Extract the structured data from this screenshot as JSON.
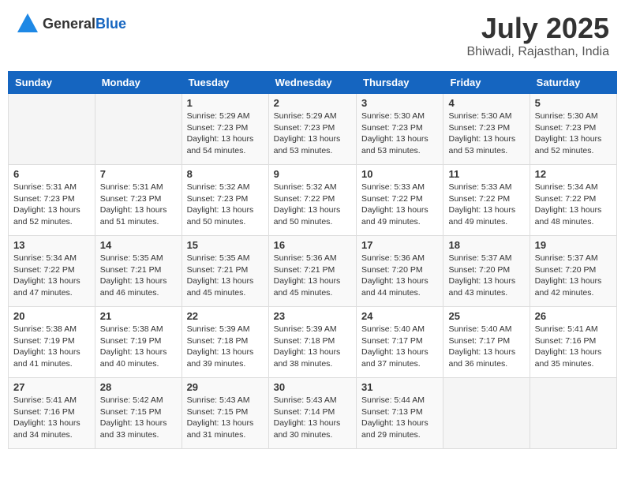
{
  "header": {
    "logo_general": "General",
    "logo_blue": "Blue",
    "month_title": "July 2025",
    "location": "Bhiwadi, Rajasthan, India"
  },
  "days_of_week": [
    "Sunday",
    "Monday",
    "Tuesday",
    "Wednesday",
    "Thursday",
    "Friday",
    "Saturday"
  ],
  "weeks": [
    [
      {
        "day": "",
        "info": ""
      },
      {
        "day": "",
        "info": ""
      },
      {
        "day": "1",
        "info": "Sunrise: 5:29 AM\nSunset: 7:23 PM\nDaylight: 13 hours\nand 54 minutes."
      },
      {
        "day": "2",
        "info": "Sunrise: 5:29 AM\nSunset: 7:23 PM\nDaylight: 13 hours\nand 53 minutes."
      },
      {
        "day": "3",
        "info": "Sunrise: 5:30 AM\nSunset: 7:23 PM\nDaylight: 13 hours\nand 53 minutes."
      },
      {
        "day": "4",
        "info": "Sunrise: 5:30 AM\nSunset: 7:23 PM\nDaylight: 13 hours\nand 53 minutes."
      },
      {
        "day": "5",
        "info": "Sunrise: 5:30 AM\nSunset: 7:23 PM\nDaylight: 13 hours\nand 52 minutes."
      }
    ],
    [
      {
        "day": "6",
        "info": "Sunrise: 5:31 AM\nSunset: 7:23 PM\nDaylight: 13 hours\nand 52 minutes."
      },
      {
        "day": "7",
        "info": "Sunrise: 5:31 AM\nSunset: 7:23 PM\nDaylight: 13 hours\nand 51 minutes."
      },
      {
        "day": "8",
        "info": "Sunrise: 5:32 AM\nSunset: 7:23 PM\nDaylight: 13 hours\nand 50 minutes."
      },
      {
        "day": "9",
        "info": "Sunrise: 5:32 AM\nSunset: 7:22 PM\nDaylight: 13 hours\nand 50 minutes."
      },
      {
        "day": "10",
        "info": "Sunrise: 5:33 AM\nSunset: 7:22 PM\nDaylight: 13 hours\nand 49 minutes."
      },
      {
        "day": "11",
        "info": "Sunrise: 5:33 AM\nSunset: 7:22 PM\nDaylight: 13 hours\nand 49 minutes."
      },
      {
        "day": "12",
        "info": "Sunrise: 5:34 AM\nSunset: 7:22 PM\nDaylight: 13 hours\nand 48 minutes."
      }
    ],
    [
      {
        "day": "13",
        "info": "Sunrise: 5:34 AM\nSunset: 7:22 PM\nDaylight: 13 hours\nand 47 minutes."
      },
      {
        "day": "14",
        "info": "Sunrise: 5:35 AM\nSunset: 7:21 PM\nDaylight: 13 hours\nand 46 minutes."
      },
      {
        "day": "15",
        "info": "Sunrise: 5:35 AM\nSunset: 7:21 PM\nDaylight: 13 hours\nand 45 minutes."
      },
      {
        "day": "16",
        "info": "Sunrise: 5:36 AM\nSunset: 7:21 PM\nDaylight: 13 hours\nand 45 minutes."
      },
      {
        "day": "17",
        "info": "Sunrise: 5:36 AM\nSunset: 7:20 PM\nDaylight: 13 hours\nand 44 minutes."
      },
      {
        "day": "18",
        "info": "Sunrise: 5:37 AM\nSunset: 7:20 PM\nDaylight: 13 hours\nand 43 minutes."
      },
      {
        "day": "19",
        "info": "Sunrise: 5:37 AM\nSunset: 7:20 PM\nDaylight: 13 hours\nand 42 minutes."
      }
    ],
    [
      {
        "day": "20",
        "info": "Sunrise: 5:38 AM\nSunset: 7:19 PM\nDaylight: 13 hours\nand 41 minutes."
      },
      {
        "day": "21",
        "info": "Sunrise: 5:38 AM\nSunset: 7:19 PM\nDaylight: 13 hours\nand 40 minutes."
      },
      {
        "day": "22",
        "info": "Sunrise: 5:39 AM\nSunset: 7:18 PM\nDaylight: 13 hours\nand 39 minutes."
      },
      {
        "day": "23",
        "info": "Sunrise: 5:39 AM\nSunset: 7:18 PM\nDaylight: 13 hours\nand 38 minutes."
      },
      {
        "day": "24",
        "info": "Sunrise: 5:40 AM\nSunset: 7:17 PM\nDaylight: 13 hours\nand 37 minutes."
      },
      {
        "day": "25",
        "info": "Sunrise: 5:40 AM\nSunset: 7:17 PM\nDaylight: 13 hours\nand 36 minutes."
      },
      {
        "day": "26",
        "info": "Sunrise: 5:41 AM\nSunset: 7:16 PM\nDaylight: 13 hours\nand 35 minutes."
      }
    ],
    [
      {
        "day": "27",
        "info": "Sunrise: 5:41 AM\nSunset: 7:16 PM\nDaylight: 13 hours\nand 34 minutes."
      },
      {
        "day": "28",
        "info": "Sunrise: 5:42 AM\nSunset: 7:15 PM\nDaylight: 13 hours\nand 33 minutes."
      },
      {
        "day": "29",
        "info": "Sunrise: 5:43 AM\nSunset: 7:15 PM\nDaylight: 13 hours\nand 31 minutes."
      },
      {
        "day": "30",
        "info": "Sunrise: 5:43 AM\nSunset: 7:14 PM\nDaylight: 13 hours\nand 30 minutes."
      },
      {
        "day": "31",
        "info": "Sunrise: 5:44 AM\nSunset: 7:13 PM\nDaylight: 13 hours\nand 29 minutes."
      },
      {
        "day": "",
        "info": ""
      },
      {
        "day": "",
        "info": ""
      }
    ]
  ]
}
